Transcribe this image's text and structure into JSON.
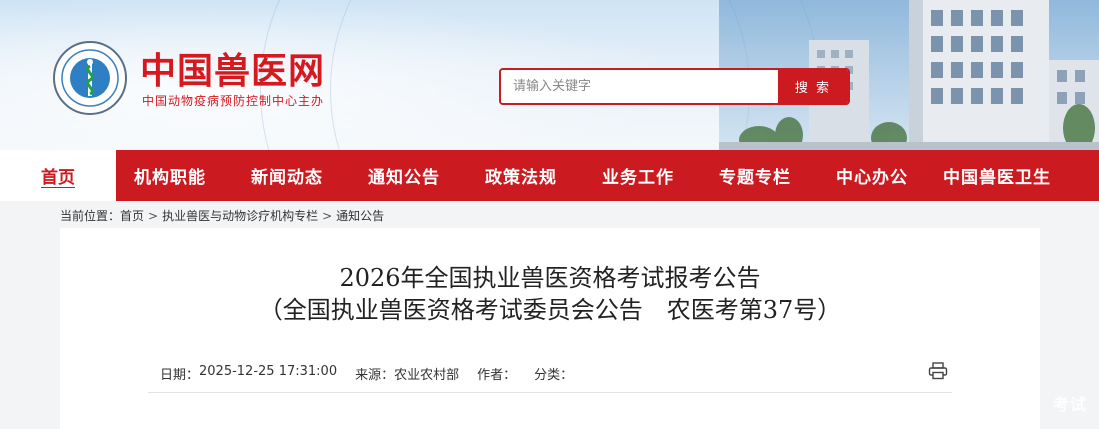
{
  "header": {
    "brand_name": "中国兽医网",
    "brand_sub": "中国动物疫病预防控制中心主办",
    "search": {
      "placeholder": "请输入关键字",
      "button_label": "搜 索"
    }
  },
  "nav": {
    "home": "首页",
    "items": [
      "机构职能",
      "新闻动态",
      "通知公告",
      "政策法规",
      "业务工作",
      "专题专栏",
      "中心办公",
      "中国兽医卫生"
    ]
  },
  "breadcrumb": {
    "prefix": "当前位置：",
    "items": [
      "首页",
      "执业兽医与动物诊疗机构专栏",
      "通知公告"
    ],
    "separator": ">"
  },
  "article": {
    "title_line1": "2026年全国执业兽医资格考试报考公告",
    "title_line2": "（全国执业兽医资格考试委员会公告　农医考第37号）",
    "date_label": "日期：",
    "date_value": "2025-12-25 17:31:00",
    "source_label": "来源：",
    "source_value": "农业农村部",
    "author_label": "作者：",
    "author_value": "",
    "category_label": "分类：",
    "category_value": ""
  },
  "icons": {
    "logo": "emblem-logo-icon",
    "print": "printer-icon"
  },
  "colors": {
    "brand_red": "#cc1a21",
    "text_dark": "#222222"
  },
  "watermark": "考试"
}
